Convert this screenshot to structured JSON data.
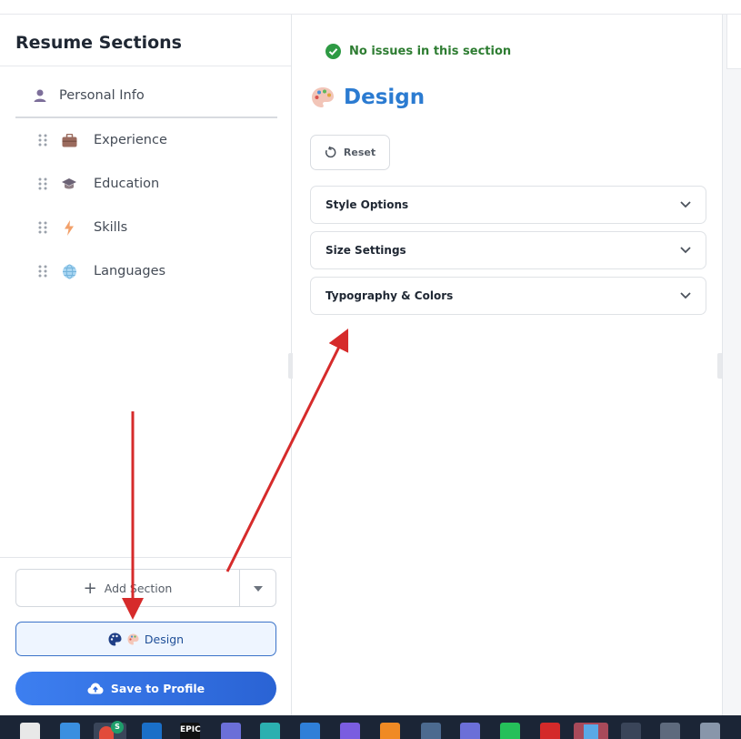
{
  "sidebar": {
    "title": "Resume Sections",
    "personal": {
      "label": "Personal Info",
      "icon": "person-icon"
    },
    "sections": [
      {
        "label": "Experience",
        "icon": "briefcase-icon"
      },
      {
        "label": "Education",
        "icon": "graduation-cap-icon"
      },
      {
        "label": "Skills",
        "icon": "lightning-icon"
      },
      {
        "label": "Languages",
        "icon": "globe-icon"
      }
    ],
    "add_section_label": "Add Section",
    "design_label": "Design",
    "save_label": "Save to Profile"
  },
  "main": {
    "status_text": "No issues in this section",
    "title": "Design",
    "reset_label": "Reset",
    "accordions": [
      {
        "label": "Style Options"
      },
      {
        "label": "Size Settings"
      },
      {
        "label": "Typography & Colors"
      }
    ]
  },
  "taskbar": {
    "epic_label": "EPIC",
    "badge_label": "S"
  },
  "colors": {
    "accent": "#2b7bd1",
    "success": "#2e7d32",
    "save_button": "#3a7bec",
    "annotation_arrow": "#d62b2b"
  }
}
